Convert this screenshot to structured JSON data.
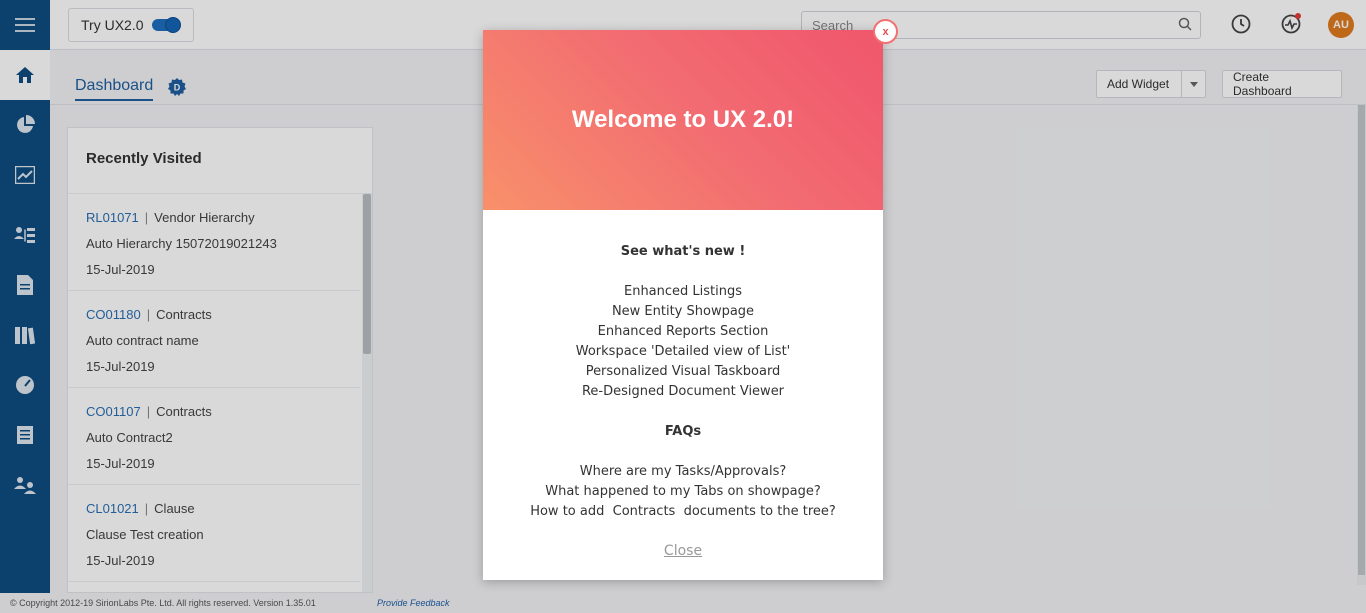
{
  "topbar": {
    "try_label": "Try UX2.0",
    "search_placeholder": "Search",
    "avatar_initials": "AU"
  },
  "subheader": {
    "tab_label": "Dashboard",
    "badge_letter": "D",
    "add_widget_label": "Add Widget",
    "create_dashboard_label": "Create Dashboard"
  },
  "recent": {
    "title": "Recently Visited",
    "items": [
      {
        "id": "RL01071",
        "type": "Vendor Hierarchy",
        "name": "Auto Hierarchy 15072019021243",
        "date": "15-Jul-2019"
      },
      {
        "id": "CO01180",
        "type": "Contracts",
        "name": "Auto contract name",
        "date": "15-Jul-2019"
      },
      {
        "id": "CO01107",
        "type": "Contracts",
        "name": "Auto Contract2",
        "date": "15-Jul-2019"
      },
      {
        "id": "CL01021",
        "type": "Clause",
        "name": "Clause Test creation",
        "date": "15-Jul-2019"
      }
    ]
  },
  "footer": {
    "copyright": "© Copyright 2012-19 SirionLabs Pte. Ltd. All rights reserved. Version 1.35.01",
    "feedback": "Provide Feedback"
  },
  "modal": {
    "title": "Welcome to UX 2.0!",
    "whats_new_heading": "See what's new !",
    "features": [
      "Enhanced Listings",
      "New Entity Showpage",
      "Enhanced Reports Section",
      "Workspace 'Detailed view of List'",
      "Personalized Visual Taskboard",
      "Re-Designed Document Viewer"
    ],
    "faq_heading": "FAQs",
    "faqs": [
      "Where are my Tasks/Approvals?",
      "What happened to my Tabs on showpage?",
      "How to add  Contracts  documents to the tree?"
    ],
    "close_label": "Close",
    "close_x": "x"
  },
  "colors": {
    "sidebar": "#0f4c81",
    "accent": "#1f5f9f",
    "modal_gradient_start": "#f8906a",
    "modal_gradient_end": "#f0566b"
  }
}
